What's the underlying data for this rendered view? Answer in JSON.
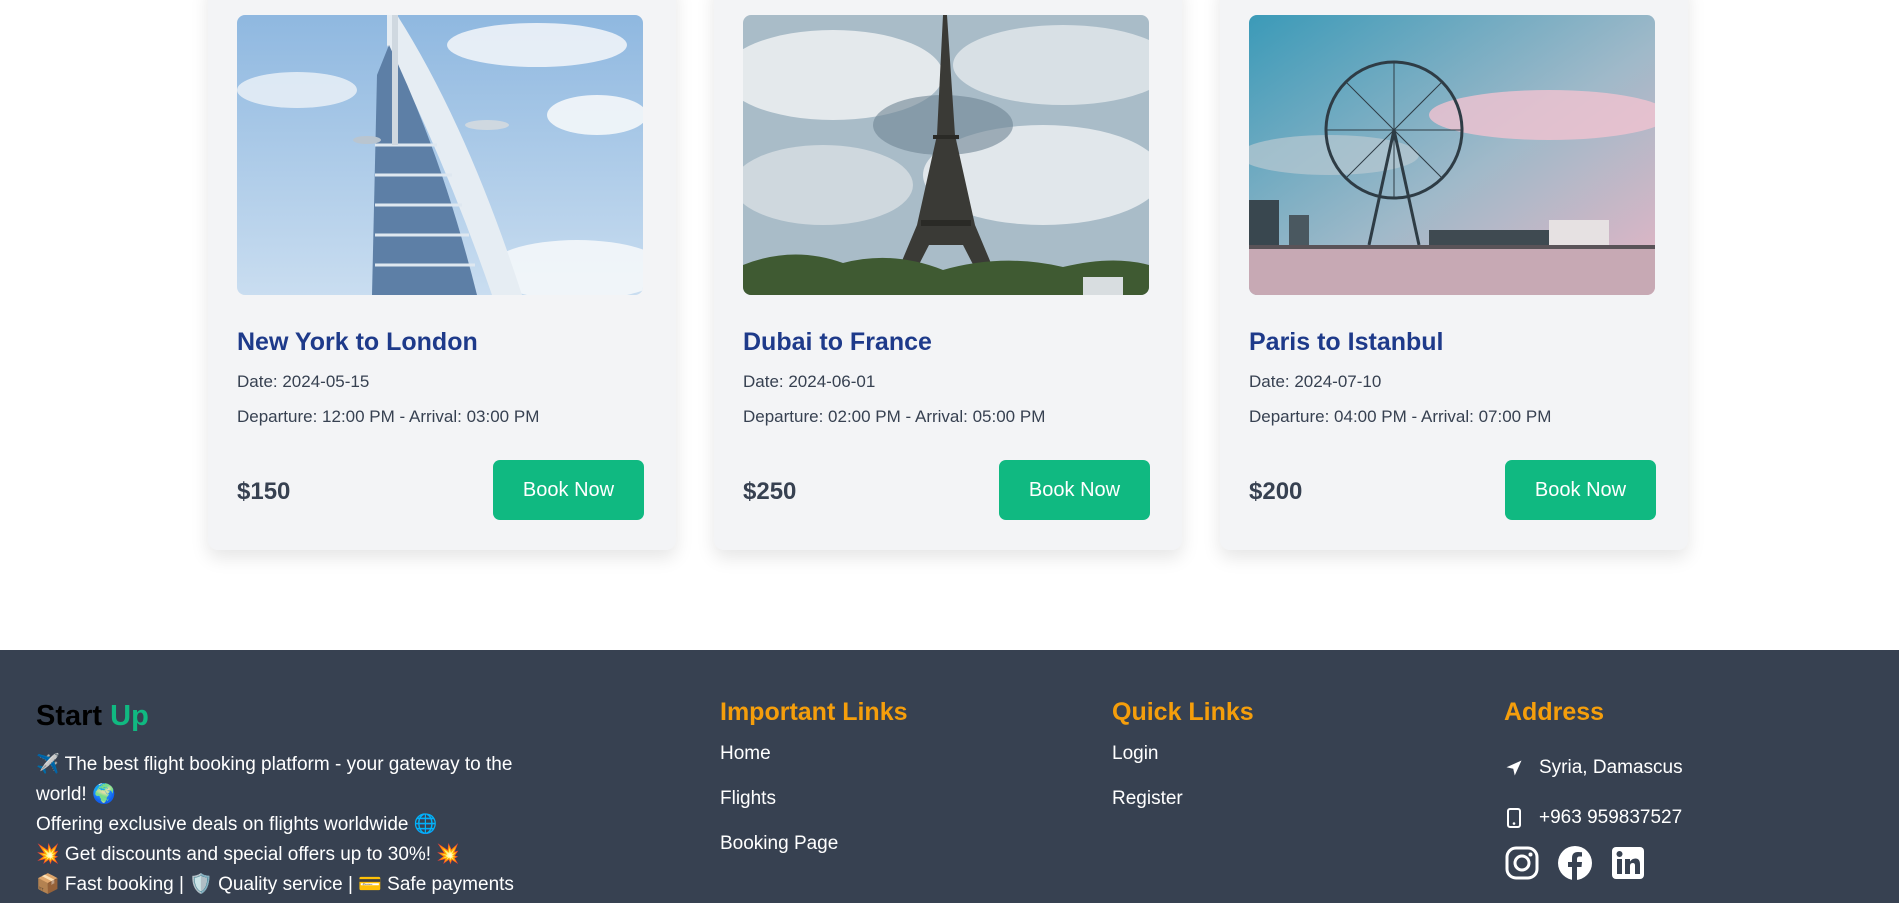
{
  "flights": [
    {
      "title": "New York to London",
      "date": "Date: 2024-05-15",
      "times": "Departure: 12:00 PM - Arrival: 03:00 PM",
      "price": "$150",
      "button": "Book Now",
      "image_icon": "burj-al-arab-photo"
    },
    {
      "title": "Dubai to France",
      "date": "Date: 2024-06-01",
      "times": "Departure: 02:00 PM - Arrival: 05:00 PM",
      "price": "$250",
      "button": "Book Now",
      "image_icon": "eiffel-tower-photo"
    },
    {
      "title": "Paris to Istanbul",
      "date": "Date: 2024-07-10",
      "times": "Departure: 04:00 PM - Arrival: 07:00 PM",
      "price": "$200",
      "button": "Book Now",
      "image_icon": "ferris-wheel-photo"
    }
  ],
  "footer": {
    "brand_part1": "Start",
    "brand_part2": "Up",
    "about_lines": [
      "✈️ The best flight booking platform - your gateway to the world! 🌍",
      "Offering exclusive deals on flights worldwide 🌐",
      "💥 Get discounts and special offers up to 30%! 💥",
      "📦 Fast booking | 🛡️ Quality service | 💳 Safe payments"
    ],
    "important_links": {
      "heading": "Important Links",
      "items": [
        "Home",
        "Flights",
        "Booking Page"
      ]
    },
    "quick_links": {
      "heading": "Quick Links",
      "items": [
        "Login",
        "Register"
      ]
    },
    "address": {
      "heading": "Address",
      "location": "Syria, Damascus",
      "phone": "+963 959837527"
    },
    "social_icons": [
      "instagram-icon",
      "facebook-icon",
      "linkedin-icon"
    ]
  },
  "colors": {
    "accent": "#10b981",
    "title": "#1e3a8a",
    "heading": "#f59e0b",
    "footer_bg": "#374151"
  }
}
